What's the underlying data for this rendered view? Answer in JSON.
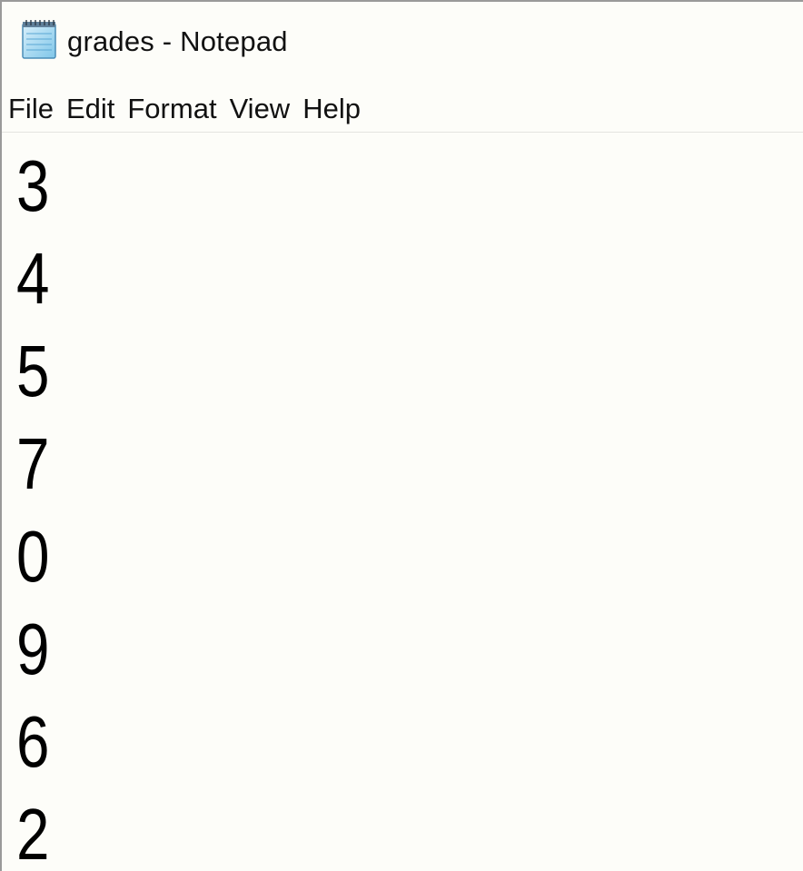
{
  "window": {
    "title": "grades - Notepad",
    "icon": "notepad-icon"
  },
  "menu": {
    "items": [
      "File",
      "Edit",
      "Format",
      "View",
      "Help"
    ]
  },
  "document": {
    "lines": [
      "3",
      "4",
      "5",
      "7",
      "0",
      "9",
      "6",
      "2"
    ]
  },
  "colors": {
    "background": "#fdfdf9",
    "text": "#000000"
  }
}
